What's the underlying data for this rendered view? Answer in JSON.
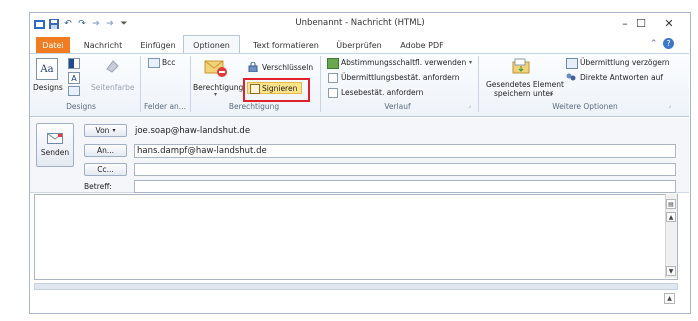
{
  "window": {
    "title": "Unbenannt - Nachricht (HTML)",
    "minimize": "–",
    "maximize": "☐",
    "close": "✕"
  },
  "tabs": [
    {
      "label": "Datei"
    },
    {
      "label": "Nachricht"
    },
    {
      "label": "Einfügen"
    },
    {
      "label": "Optionen"
    },
    {
      "label": "Text formatieren"
    },
    {
      "label": "Überprüfen"
    },
    {
      "label": "Adobe PDF"
    }
  ],
  "ribbon": {
    "designs": {
      "designs_label": "Designs",
      "seitenfarbe": "Seitenfarbe",
      "group": "Designs"
    },
    "felder": {
      "bcc": "Bcc",
      "group": "Felder an..."
    },
    "berechtigung": {
      "berechtigung": "Berechtigung",
      "verschluesseln": "Verschlüsseln",
      "signieren": "Signieren",
      "group": "Berechtigung"
    },
    "verlauf": {
      "abstimmung": "Abstimmungsschaltfl. verwenden",
      "uebermittlung": "Übermittlungsbestät. anfordern",
      "lesebestaet": "Lesebestät. anfordern",
      "group": "Verlauf"
    },
    "weitere": {
      "gesendetes_line1": "Gesendetes Element",
      "gesendetes_line2": "speichern unter",
      "verzoegern": "Übermittlung verzögern",
      "direkte": "Direkte Antworten auf",
      "group": "Weitere Optionen"
    }
  },
  "form": {
    "senden": "Senden",
    "von_label": "Von",
    "von_value": "joe.soap@haw-landshut.de",
    "an_label": "An...",
    "an_value": "hans.dampf@haw-landshut.de",
    "cc_label": "Cc...",
    "cc_value": "",
    "betreff_label": "Betreff:",
    "betreff_value": ""
  },
  "colors": {
    "file_tab": "#f27c21",
    "highlight": "#e0202b",
    "signieren_bg": "#fde48a"
  }
}
